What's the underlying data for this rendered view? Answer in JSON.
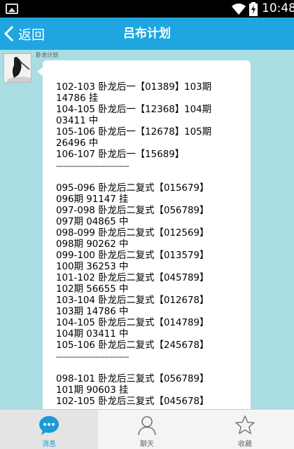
{
  "status_bar": {
    "time": "10:48"
  },
  "header": {
    "back_label": "返回",
    "title": "吕布计划"
  },
  "chat": {
    "sender_name": "卧龙计划",
    "message_blocks": [
      {
        "lines": [
          "102-103 卧龙后一【01389】103期",
          "14786 挂",
          "104-105 卧龙后一【12368】104期",
          "03411 中",
          "105-106 卧龙后一【12678】105期",
          "26496 中",
          "106-107 卧龙后一【15689】"
        ],
        "separator": "------------------------------"
      },
      {
        "lines": [
          "095-096 卧龙后二复式【015679】",
          "096期 91147 挂",
          "097-098 卧龙后二复式【056789】",
          "097期 04865 中",
          "098-099 卧龙后二复式【012569】",
          "098期 90262 中",
          "099-100 卧龙后二复式【013579】",
          "100期 36253 中",
          "101-102 卧龙后二复式【045789】",
          "102期 56655 中",
          "103-104 卧龙后二复式【012678】",
          "103期 14786 中",
          "104-105 卧龙后二复式【014789】",
          "104期 03411 中",
          "105-106 卧龙后二复式【245678】"
        ],
        "separator": "------------------------------"
      },
      {
        "lines": [
          "098-101 卧龙后三复式【056789】",
          "101期 90603 挂",
          "102-105 卧龙后三复式【045678】"
        ]
      }
    ]
  },
  "tabs": [
    {
      "label": "消息",
      "icon": "chat-bubble-icon",
      "active": true
    },
    {
      "label": "聊天",
      "icon": "person-icon",
      "active": false
    },
    {
      "label": "收藏",
      "icon": "star-icon",
      "active": false
    }
  ],
  "colors": {
    "header": "#1fa6e0",
    "chat_background": "#a9dde2",
    "tab_active": "#1a9ad6"
  }
}
